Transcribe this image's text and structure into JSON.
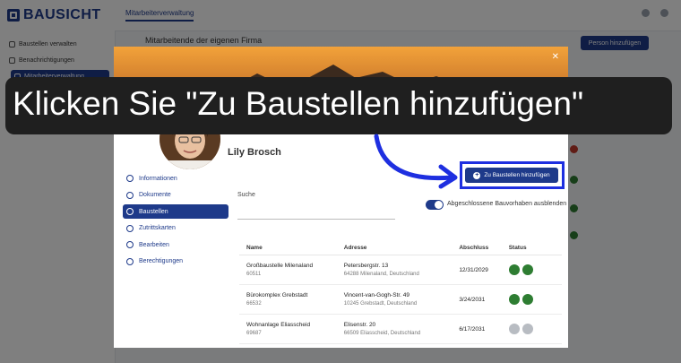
{
  "app": {
    "logo_text": "BAUSICHT",
    "top_tab": "Mitarbeiterverwaltung",
    "sidebar": [
      {
        "label": "Baustellen verwalten"
      },
      {
        "label": "Benachrichtigungen"
      },
      {
        "label": "Mitarbeiterverwaltung",
        "active": true
      }
    ],
    "page_title": "Mitarbeitende der eigenen Firma",
    "primary_button": "Person hinzufügen"
  },
  "modal": {
    "person_name": "Lily Brosch",
    "nav": [
      {
        "label": "Informationen",
        "icon": "info-icon"
      },
      {
        "label": "Dokumente",
        "icon": "document-icon"
      },
      {
        "label": "Baustellen",
        "icon": "crane-icon",
        "active": true
      },
      {
        "label": "Zutrittskarten",
        "icon": "card-icon"
      },
      {
        "label": "Bearbeiten",
        "icon": "edit-icon"
      },
      {
        "label": "Berechtigungen",
        "icon": "key-icon"
      }
    ],
    "add_button": "Zu Baustellen hinzufügen",
    "search_label": "Suche",
    "search_value": "",
    "toggle_label": "Abgeschlossene Bauvorhaben ausblenden",
    "toggle_on": true,
    "table": {
      "headers": [
        "Name",
        "Adresse",
        "Abschluss",
        "Status"
      ],
      "rows": [
        {
          "name": "Großbaustelle Milenaland",
          "id": "60511",
          "street": "Petersbergstr. 13",
          "city": "64288 Milenaland, Deutschland",
          "date": "12/31/2029",
          "status_active": true
        },
        {
          "name": "Bürokomplex Grebstadt",
          "id": "66532",
          "street": "Vincent-van-Gogh-Str. 49",
          "city": "10245 Grebstadt, Deutschland",
          "date": "3/24/2031",
          "status_active": true
        },
        {
          "name": "Wohnanlage Eliasscheid",
          "id": "69687",
          "street": "Elisenstr. 20",
          "city": "66509 Eliasscheid, Deutschland",
          "date": "6/17/2031",
          "status_active": false
        }
      ]
    }
  },
  "instruction": "Klicken Sie \"Zu Baustellen hinzufügen\"",
  "colors": {
    "accent": "#1e3a8a",
    "highlight": "#1e2fe0",
    "status_green": "#2e7d32"
  }
}
